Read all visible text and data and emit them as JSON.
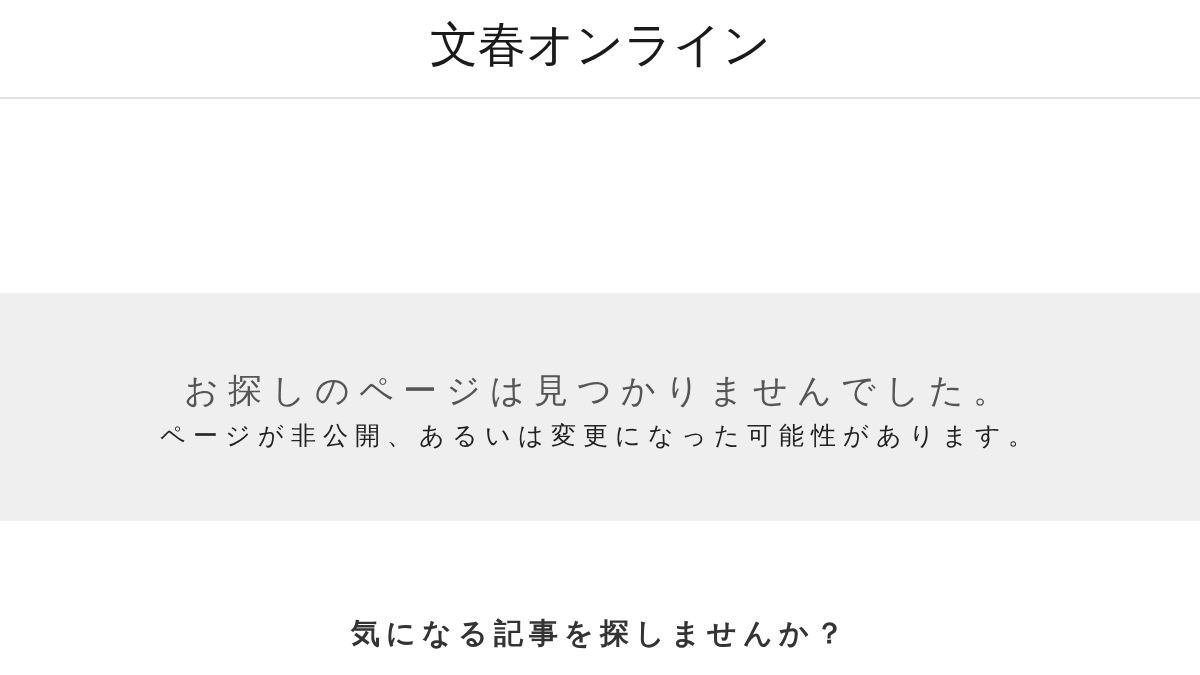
{
  "header": {
    "logo": "文春オンライン"
  },
  "error_notice": {
    "title": "お探しのページは見つかりませんでした。",
    "message": "ページが非公開、あるいは変更になった可能性があります。"
  },
  "related": {
    "heading": "気になる記事を探しませんか？"
  }
}
